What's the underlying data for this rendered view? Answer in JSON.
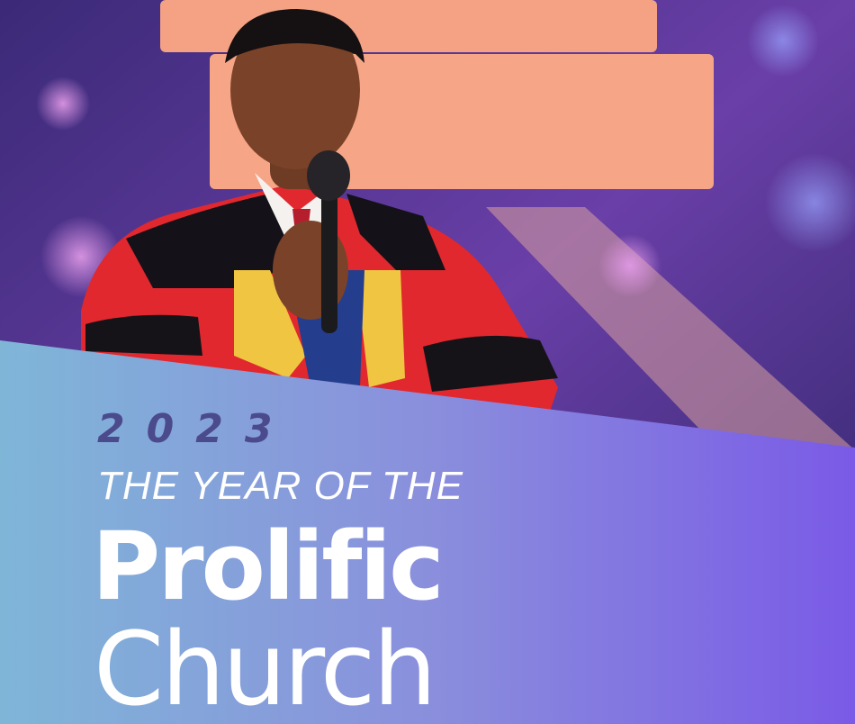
{
  "banner": {
    "year": "2023",
    "tagline": "THE YEAR OF THE",
    "title_line1": "Prolific",
    "title_line2": "Church"
  },
  "colors": {
    "band_left": "#7fb6d8",
    "band_right": "#7a5ae6",
    "year_text": "#4b4a8c",
    "robe_red": "#e0282e"
  }
}
